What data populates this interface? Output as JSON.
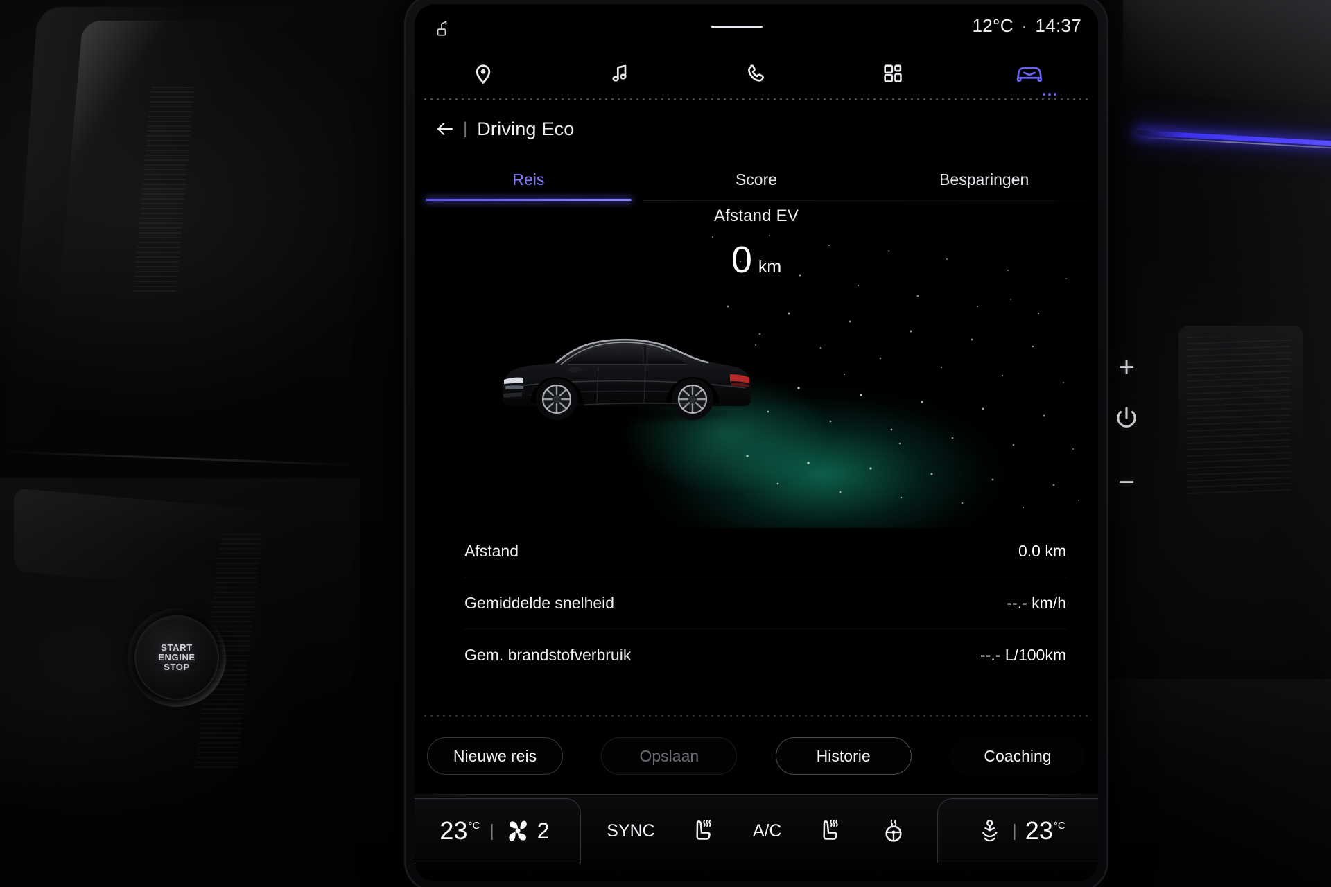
{
  "statusbar": {
    "antenna_icon": "antenna-radio-icon",
    "temperature": "12°C",
    "separator": "·",
    "time": "14:37"
  },
  "navbar": {
    "items": [
      {
        "icon": "location-pin-icon",
        "name": "navigation",
        "active": false
      },
      {
        "icon": "music-note-icon",
        "name": "media",
        "active": false
      },
      {
        "icon": "phone-icon",
        "name": "phone",
        "active": false
      },
      {
        "icon": "apps-grid-icon",
        "name": "apps",
        "active": false
      },
      {
        "icon": "car-icon",
        "name": "vehicle",
        "active": true
      }
    ]
  },
  "header": {
    "back_icon": "back-arrow-icon",
    "divider": "|",
    "title": "Driving Eco"
  },
  "tabs": [
    {
      "label": "Reis",
      "active": true
    },
    {
      "label": "Score",
      "active": false
    },
    {
      "label": "Besparingen",
      "active": false
    }
  ],
  "hero": {
    "label": "Afstand EV",
    "value": "0",
    "unit": "km",
    "vehicle_icon": "suv-side-view",
    "glow_color": "#1abe96"
  },
  "stats": [
    {
      "label": "Afstand",
      "value": "0.0 km"
    },
    {
      "label": "Gemiddelde snelheid",
      "value": "--.- km/h"
    },
    {
      "label": "Gem. brandstofverbruik",
      "value": "--.- L/100km"
    }
  ],
  "actions": [
    {
      "label": "Nieuwe reis",
      "state": "enabled"
    },
    {
      "label": "Opslaan",
      "state": "disabled"
    },
    {
      "label": "Historie",
      "state": "enabled"
    },
    {
      "label": "Coaching",
      "state": "enabled"
    }
  ],
  "climate": {
    "left_temp": "23",
    "left_temp_unit": "°C",
    "pipe": "|",
    "fan_icon": "fan-icon",
    "fan_speed": "2",
    "sync_label": "SYNC",
    "seat_heat_left_icon": "seat-heater-icon",
    "ac_label": "A/C",
    "seat_heat_right_icon": "seat-heater-icon",
    "steering_heat_icon": "steering-wheel-heater-icon",
    "airflow_icon": "airflow-direction-icon",
    "right_temp": "23",
    "right_temp_unit": "°C"
  },
  "hardware": {
    "volume_up": "+",
    "volume_down": "−",
    "power_icon": "power-icon"
  },
  "dashboard": {
    "start_button_line1": "START",
    "start_button_line2": "ENGINE",
    "start_button_line3": "STOP"
  },
  "colors": {
    "accent": "#7f78ff",
    "glow_green": "#1abe96",
    "ambient_blue": "#4a40ff",
    "text_primary": "#f0f1f5"
  }
}
